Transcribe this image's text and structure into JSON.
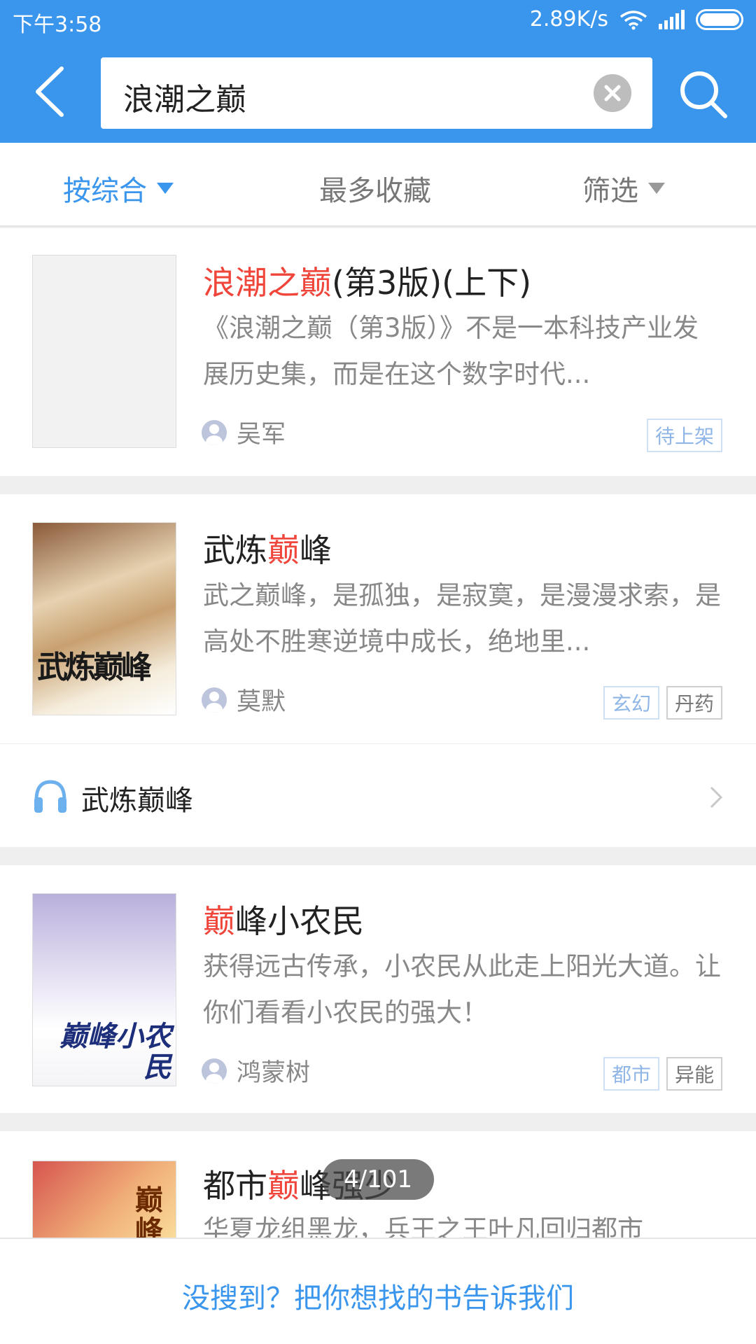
{
  "status_bar": {
    "time": "下午3:58",
    "network_speed": "2.89K/s"
  },
  "search": {
    "query": "浪潮之巅"
  },
  "filters": [
    {
      "label": "按综合",
      "active": true
    },
    {
      "label": "最多收藏",
      "active": false
    },
    {
      "label": "筛选",
      "active": false
    }
  ],
  "books": [
    {
      "title_highlight": "浪潮之巅",
      "title_rest": "(第3版)(上下)",
      "description": "《浪潮之巅（第3版）》不是一本科技产业发展历史集，而是在这个数字时代...",
      "author": "吴军",
      "tags": [
        "待上架"
      ]
    },
    {
      "title_pre": "武炼",
      "title_highlight": "巅",
      "title_post": "峰",
      "description": "武之巅峰，是孤独，是寂寞，是漫漫求索，是高处不胜寒逆境中成长，绝地里...",
      "author": "莫默",
      "tags": [
        "玄幻",
        "丹药"
      ],
      "cover_text": "武炼巅峰"
    },
    {
      "title_highlight": "巅",
      "title_post": "峰小农民",
      "description": "获得远古传承，小农民从此走上阳光大道。让你们看看小农民的强大！",
      "author": "鸿蒙树",
      "tags": [
        "都市",
        "异能"
      ],
      "cover_text": "巅峰小农民"
    },
    {
      "title_pre": "都市",
      "title_highlight": "巅",
      "title_post": "峰强少",
      "description": "华夏龙组黑龙，兵王之王叶凡回归都市",
      "cover_text": "巅峰"
    }
  ],
  "audio_item": {
    "title": "武炼巅峰"
  },
  "page_indicator": "4/101",
  "feedback_link": "没搜到？把你想找的书告诉我们",
  "colors": {
    "primary": "#3a95ec",
    "highlight": "#f0453a",
    "tag_blue": "#8fb6e6"
  }
}
